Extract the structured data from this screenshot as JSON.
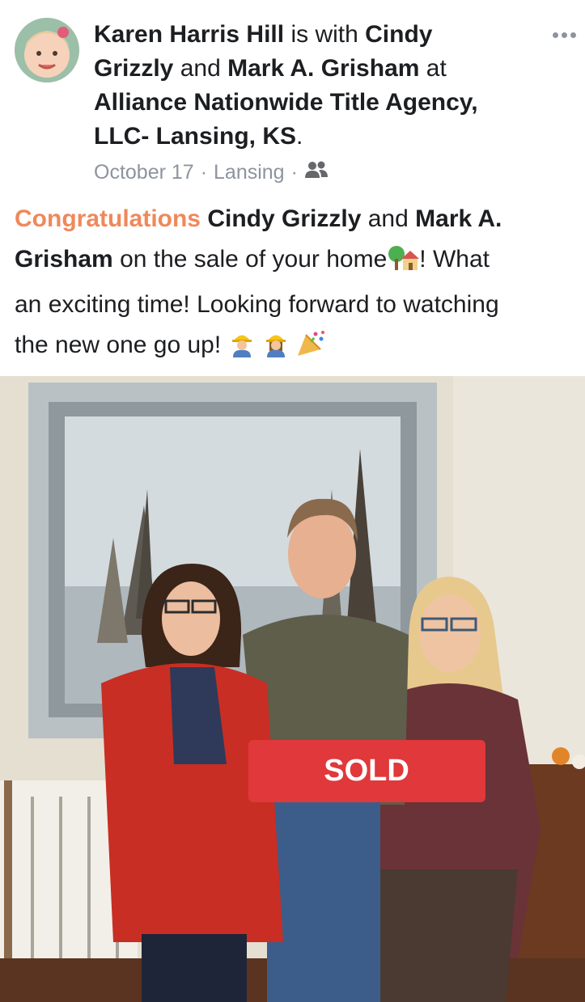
{
  "post": {
    "author": "Karen Harris Hill",
    "is_with": "is with",
    "person1": "Cindy",
    "person1_last": "Grizzly",
    "and1": "and",
    "person2": "Mark A. Grisham",
    "at": "at",
    "place_line1": "Alliance Nationwide Title Agency,",
    "place_line2": "LLC- Lansing, KS",
    "period": ".",
    "date": "October 17",
    "location": "Lansing",
    "audience_icon": "friends-icon",
    "more_icon": "more-icon"
  },
  "message": {
    "congrats": "Congratulations",
    "name1": "Cindy Grizzly",
    "and": "and",
    "name2_a": "Mark A.",
    "name2_b": "Grisham",
    "part1": "on the sale of your home",
    "part2": "! What",
    "line3": "an exciting time! Looking forward to watching",
    "line4": "the new one go up!"
  },
  "photo": {
    "sign_text": "SOLD"
  },
  "colors": {
    "highlight": "#f0885a",
    "text": "#1c1e21",
    "meta": "#8d949e",
    "sign": "#e0383b"
  }
}
